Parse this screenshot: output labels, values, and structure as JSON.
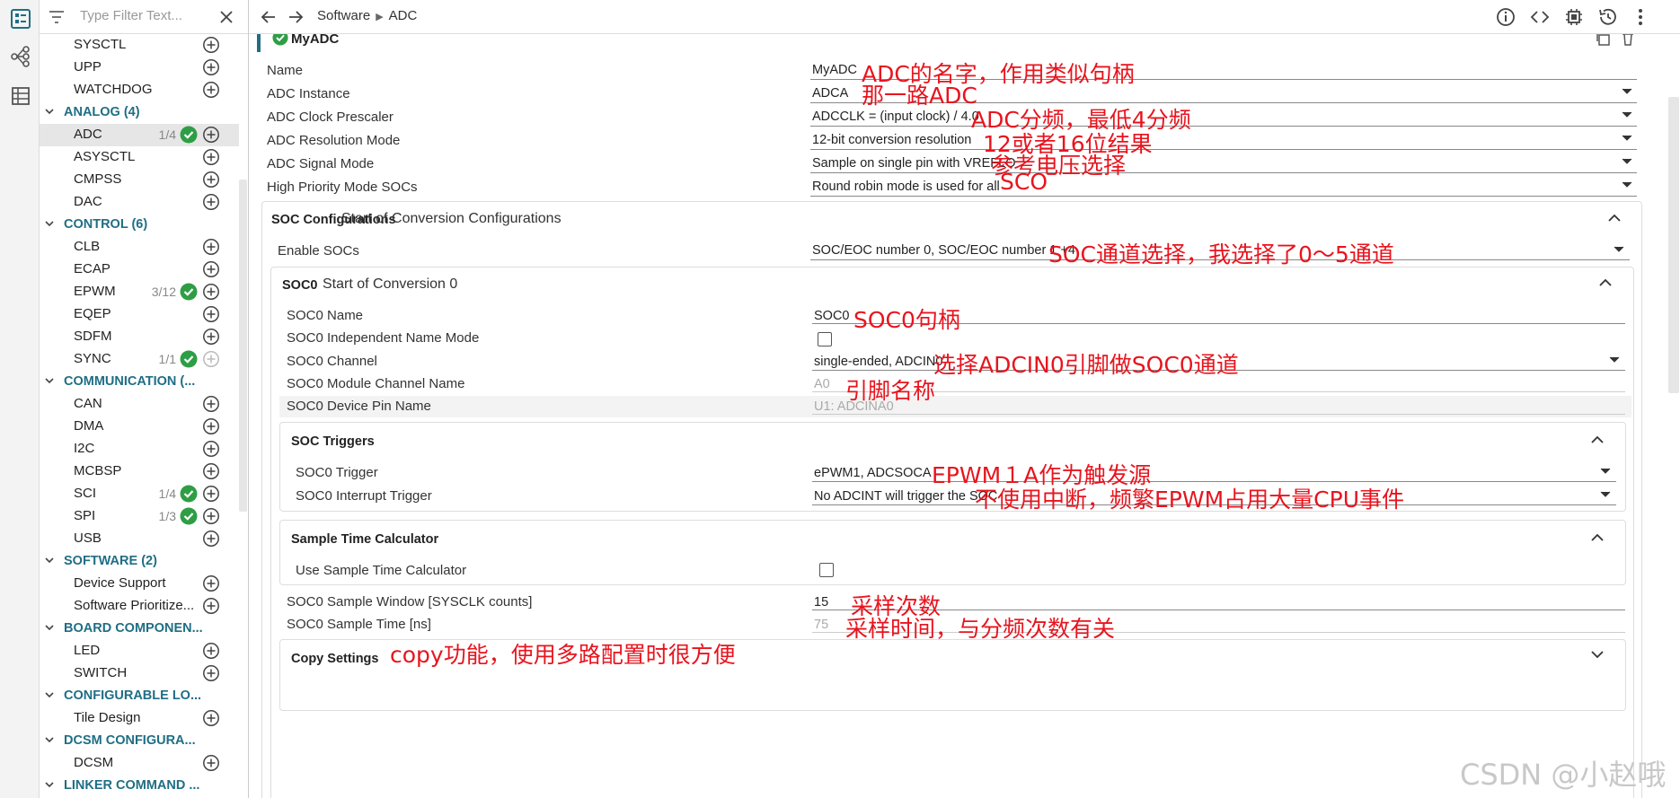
{
  "sidebar": {
    "filter_placeholder": "Type Filter Text...",
    "tree": [
      {
        "kind": "item",
        "label": "SYSCTL"
      },
      {
        "kind": "item",
        "label": "UPP"
      },
      {
        "kind": "item",
        "label": "WATCHDOG"
      },
      {
        "kind": "cat",
        "label": "ANALOG (4)"
      },
      {
        "kind": "item",
        "label": "ADC",
        "count": "1/4",
        "checked": true,
        "selected": true
      },
      {
        "kind": "item",
        "label": "ASYSCTL"
      },
      {
        "kind": "item",
        "label": "CMPSS"
      },
      {
        "kind": "item",
        "label": "DAC"
      },
      {
        "kind": "cat",
        "label": "CONTROL (6)"
      },
      {
        "kind": "item",
        "label": "CLB"
      },
      {
        "kind": "item",
        "label": "ECAP"
      },
      {
        "kind": "item",
        "label": "EPWM",
        "count": "3/12",
        "checked": true
      },
      {
        "kind": "item",
        "label": "EQEP"
      },
      {
        "kind": "item",
        "label": "SDFM"
      },
      {
        "kind": "item",
        "label": "SYNC",
        "count": "1/1",
        "checked": true,
        "disabled": true
      },
      {
        "kind": "cat",
        "label": "COMMUNICATION (..."
      },
      {
        "kind": "item",
        "label": "CAN"
      },
      {
        "kind": "item",
        "label": "DMA"
      },
      {
        "kind": "item",
        "label": "I2C"
      },
      {
        "kind": "item",
        "label": "MCBSP"
      },
      {
        "kind": "item",
        "label": "SCI",
        "count": "1/4",
        "checked": true
      },
      {
        "kind": "item",
        "label": "SPI",
        "count": "1/3",
        "checked": true
      },
      {
        "kind": "item",
        "label": "USB"
      },
      {
        "kind": "cat",
        "label": "SOFTWARE (2)"
      },
      {
        "kind": "item",
        "label": "Device Support"
      },
      {
        "kind": "item",
        "label": "Software Prioritize..."
      },
      {
        "kind": "cat",
        "label": "BOARD COMPONEN..."
      },
      {
        "kind": "item",
        "label": "LED"
      },
      {
        "kind": "item",
        "label": "SWITCH"
      },
      {
        "kind": "cat",
        "label": "CONFIGURABLE LO..."
      },
      {
        "kind": "item",
        "label": "Tile Design"
      },
      {
        "kind": "cat",
        "label": "DCSM CONFIGURA..."
      },
      {
        "kind": "item",
        "label": "DCSM"
      },
      {
        "kind": "cat",
        "label": "LINKER COMMAND ..."
      }
    ]
  },
  "breadcrumb": {
    "parent": "Software",
    "current": "ADC"
  },
  "instance_title": "MyADC",
  "fields": {
    "name": {
      "label": "Name",
      "value": "MyADC"
    },
    "adc_instance": {
      "label": "ADC Instance",
      "value": "ADCA"
    },
    "prescaler": {
      "label": "ADC Clock Prescaler",
      "value": "ADCCLK = (input clock) / 4.0"
    },
    "resolution": {
      "label": "ADC Resolution Mode",
      "value": "12-bit conversion resolution"
    },
    "signal_mode": {
      "label": "ADC Signal Mode",
      "value": "Sample on single pin with VREFLO"
    },
    "priority": {
      "label": "High Priority Mode SOCs",
      "value": "Round robin mode is used for all"
    }
  },
  "soc_config": {
    "title": "SOC Configurations",
    "subtitle": "Start of Conversion Configurations",
    "enable_label": "Enable SOCs",
    "enable_value": "SOC/EOC number 0, SOC/EOC number 1 +4"
  },
  "soc0": {
    "title": "SOC0",
    "subtitle": "Start of Conversion 0",
    "name_label": "SOC0 Name",
    "name_value": "SOC0",
    "indep_label": "SOC0 Independent Name Mode",
    "channel_label": "SOC0 Channel",
    "channel_value": "single-ended, ADCIN0",
    "module_label": "SOC0 Module Channel Name",
    "module_value": "A0",
    "pin_label": "SOC0 Device Pin Name",
    "pin_value": "U1: ADCINA0",
    "window_label": "SOC0 Sample Window [SYSCLK counts]",
    "window_value": "15",
    "time_label": "SOC0 Sample Time [ns]",
    "time_value": "75"
  },
  "triggers": {
    "title": "SOC Triggers",
    "trigger_label": "SOC0 Trigger",
    "trigger_value": "ePWM1, ADCSOCA",
    "int_label": "SOC0 Interrupt Trigger",
    "int_value": "No ADCINT will trigger the SOC"
  },
  "calc": {
    "title": "Sample Time Calculator",
    "use_label": "Use Sample Time Calculator"
  },
  "copy": {
    "title": "Copy Settings"
  },
  "annotations": {
    "name": "ADC的名字，作用类似句柄",
    "instance": "那一路ADC",
    "prescaler": "ADC分频，最低4分频",
    "resolution": "12或者16位结果",
    "signal": "参考电压选择",
    "priority": "SCO",
    "enable": "SOC通道选择，我选择了0～5通道",
    "soc_name": "SOC0句柄",
    "channel": "选择ADCIN0引脚做SOC0通道",
    "pin": "引脚名称",
    "trigger": "EPWM１A作为触发源",
    "interrupt": "不使用中断，频繁EPWM占用大量CPU事件",
    "window": "采样次数",
    "time": "采样时间，与分频次数有关",
    "copy": "copy功能，使用多路配置时很方便"
  },
  "watermark": "CSDN @小赵哦",
  "colors": {
    "accent": "#1f6e85",
    "check": "#2e9e45",
    "annotation": "#e8141e"
  }
}
